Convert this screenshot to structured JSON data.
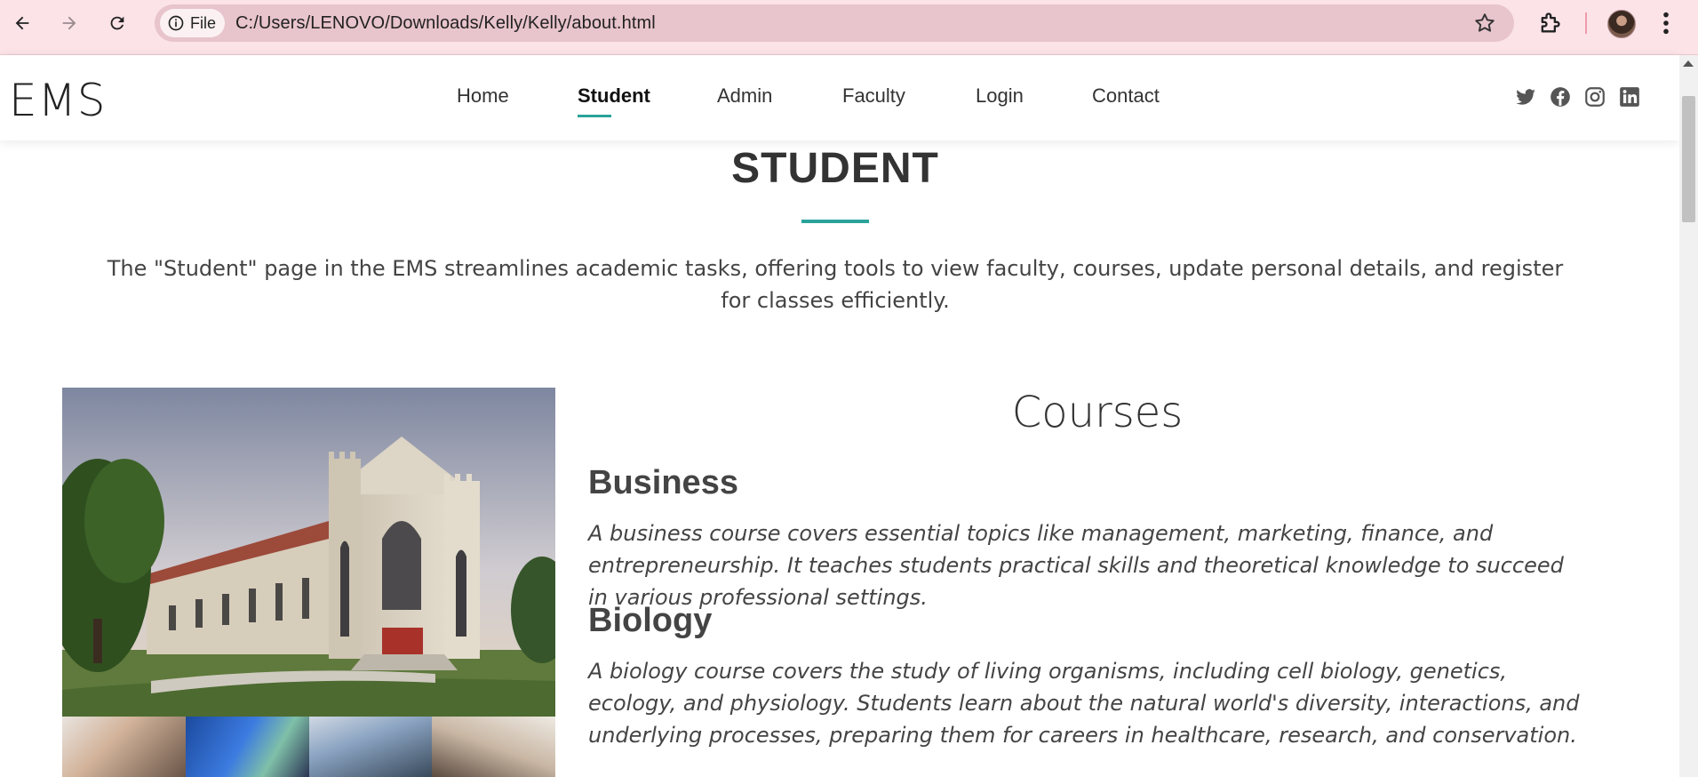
{
  "browser": {
    "url": "C:/Users/LENOVO/Downloads/Kelly/Kelly/about.html",
    "file_chip_label": "File",
    "icons": [
      "back-arrow-icon",
      "forward-arrow-icon",
      "reload-icon",
      "info-icon",
      "star-icon",
      "extensions-icon",
      "profile-avatar",
      "more-vert-icon"
    ],
    "chrome_color": "#fbe3e8"
  },
  "header": {
    "logo": "EMS",
    "nav": [
      {
        "label": "Home"
      },
      {
        "label": "Student",
        "active": true
      },
      {
        "label": "Admin"
      },
      {
        "label": "Faculty"
      },
      {
        "label": "Login"
      },
      {
        "label": "Contact"
      }
    ],
    "social": [
      "twitter-icon",
      "facebook-icon",
      "instagram-icon",
      "linkedin-icon"
    ],
    "accent_color": "#2aa39a"
  },
  "page": {
    "title": "STUDENT",
    "intro": "The \"Student\" page in the EMS streamlines academic tasks, offering tools to view faculty, courses, update personal details, and register for classes efficiently."
  },
  "courses": {
    "heading": "Courses",
    "items": [
      {
        "name": "Business",
        "description": "A business course covers essential topics like management, marketing, finance, and entrepreneurship. It teaches students practical skills and theoretical knowledge to succeed in various professional settings."
      },
      {
        "name": "Biology",
        "description": "A biology course covers the study of living organisms, including cell biology, genetics, ecology, and physiology. Students learn about the natural world's diversity, interactions, and underlying processes, preparing them for careers in healthcare, research, and conservation."
      }
    ]
  }
}
